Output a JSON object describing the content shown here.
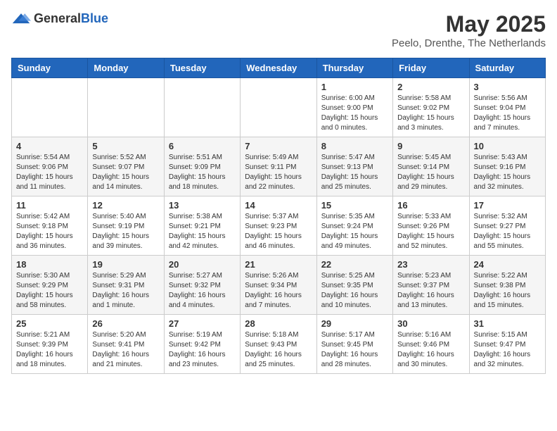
{
  "header": {
    "logo_general": "General",
    "logo_blue": "Blue",
    "month": "May 2025",
    "location": "Peelo, Drenthe, The Netherlands"
  },
  "weekdays": [
    "Sunday",
    "Monday",
    "Tuesday",
    "Wednesday",
    "Thursday",
    "Friday",
    "Saturday"
  ],
  "weeks": [
    [
      {
        "day": "",
        "info": ""
      },
      {
        "day": "",
        "info": ""
      },
      {
        "day": "",
        "info": ""
      },
      {
        "day": "",
        "info": ""
      },
      {
        "day": "1",
        "info": "Sunrise: 6:00 AM\nSunset: 9:00 PM\nDaylight: 15 hours\nand 0 minutes."
      },
      {
        "day": "2",
        "info": "Sunrise: 5:58 AM\nSunset: 9:02 PM\nDaylight: 15 hours\nand 3 minutes."
      },
      {
        "day": "3",
        "info": "Sunrise: 5:56 AM\nSunset: 9:04 PM\nDaylight: 15 hours\nand 7 minutes."
      }
    ],
    [
      {
        "day": "4",
        "info": "Sunrise: 5:54 AM\nSunset: 9:06 PM\nDaylight: 15 hours\nand 11 minutes."
      },
      {
        "day": "5",
        "info": "Sunrise: 5:52 AM\nSunset: 9:07 PM\nDaylight: 15 hours\nand 14 minutes."
      },
      {
        "day": "6",
        "info": "Sunrise: 5:51 AM\nSunset: 9:09 PM\nDaylight: 15 hours\nand 18 minutes."
      },
      {
        "day": "7",
        "info": "Sunrise: 5:49 AM\nSunset: 9:11 PM\nDaylight: 15 hours\nand 22 minutes."
      },
      {
        "day": "8",
        "info": "Sunrise: 5:47 AM\nSunset: 9:13 PM\nDaylight: 15 hours\nand 25 minutes."
      },
      {
        "day": "9",
        "info": "Sunrise: 5:45 AM\nSunset: 9:14 PM\nDaylight: 15 hours\nand 29 minutes."
      },
      {
        "day": "10",
        "info": "Sunrise: 5:43 AM\nSunset: 9:16 PM\nDaylight: 15 hours\nand 32 minutes."
      }
    ],
    [
      {
        "day": "11",
        "info": "Sunrise: 5:42 AM\nSunset: 9:18 PM\nDaylight: 15 hours\nand 36 minutes."
      },
      {
        "day": "12",
        "info": "Sunrise: 5:40 AM\nSunset: 9:19 PM\nDaylight: 15 hours\nand 39 minutes."
      },
      {
        "day": "13",
        "info": "Sunrise: 5:38 AM\nSunset: 9:21 PM\nDaylight: 15 hours\nand 42 minutes."
      },
      {
        "day": "14",
        "info": "Sunrise: 5:37 AM\nSunset: 9:23 PM\nDaylight: 15 hours\nand 46 minutes."
      },
      {
        "day": "15",
        "info": "Sunrise: 5:35 AM\nSunset: 9:24 PM\nDaylight: 15 hours\nand 49 minutes."
      },
      {
        "day": "16",
        "info": "Sunrise: 5:33 AM\nSunset: 9:26 PM\nDaylight: 15 hours\nand 52 minutes."
      },
      {
        "day": "17",
        "info": "Sunrise: 5:32 AM\nSunset: 9:27 PM\nDaylight: 15 hours\nand 55 minutes."
      }
    ],
    [
      {
        "day": "18",
        "info": "Sunrise: 5:30 AM\nSunset: 9:29 PM\nDaylight: 15 hours\nand 58 minutes."
      },
      {
        "day": "19",
        "info": "Sunrise: 5:29 AM\nSunset: 9:31 PM\nDaylight: 16 hours\nand 1 minute."
      },
      {
        "day": "20",
        "info": "Sunrise: 5:27 AM\nSunset: 9:32 PM\nDaylight: 16 hours\nand 4 minutes."
      },
      {
        "day": "21",
        "info": "Sunrise: 5:26 AM\nSunset: 9:34 PM\nDaylight: 16 hours\nand 7 minutes."
      },
      {
        "day": "22",
        "info": "Sunrise: 5:25 AM\nSunset: 9:35 PM\nDaylight: 16 hours\nand 10 minutes."
      },
      {
        "day": "23",
        "info": "Sunrise: 5:23 AM\nSunset: 9:37 PM\nDaylight: 16 hours\nand 13 minutes."
      },
      {
        "day": "24",
        "info": "Sunrise: 5:22 AM\nSunset: 9:38 PM\nDaylight: 16 hours\nand 15 minutes."
      }
    ],
    [
      {
        "day": "25",
        "info": "Sunrise: 5:21 AM\nSunset: 9:39 PM\nDaylight: 16 hours\nand 18 minutes."
      },
      {
        "day": "26",
        "info": "Sunrise: 5:20 AM\nSunset: 9:41 PM\nDaylight: 16 hours\nand 21 minutes."
      },
      {
        "day": "27",
        "info": "Sunrise: 5:19 AM\nSunset: 9:42 PM\nDaylight: 16 hours\nand 23 minutes."
      },
      {
        "day": "28",
        "info": "Sunrise: 5:18 AM\nSunset: 9:43 PM\nDaylight: 16 hours\nand 25 minutes."
      },
      {
        "day": "29",
        "info": "Sunrise: 5:17 AM\nSunset: 9:45 PM\nDaylight: 16 hours\nand 28 minutes."
      },
      {
        "day": "30",
        "info": "Sunrise: 5:16 AM\nSunset: 9:46 PM\nDaylight: 16 hours\nand 30 minutes."
      },
      {
        "day": "31",
        "info": "Sunrise: 5:15 AM\nSunset: 9:47 PM\nDaylight: 16 hours\nand 32 minutes."
      }
    ]
  ]
}
